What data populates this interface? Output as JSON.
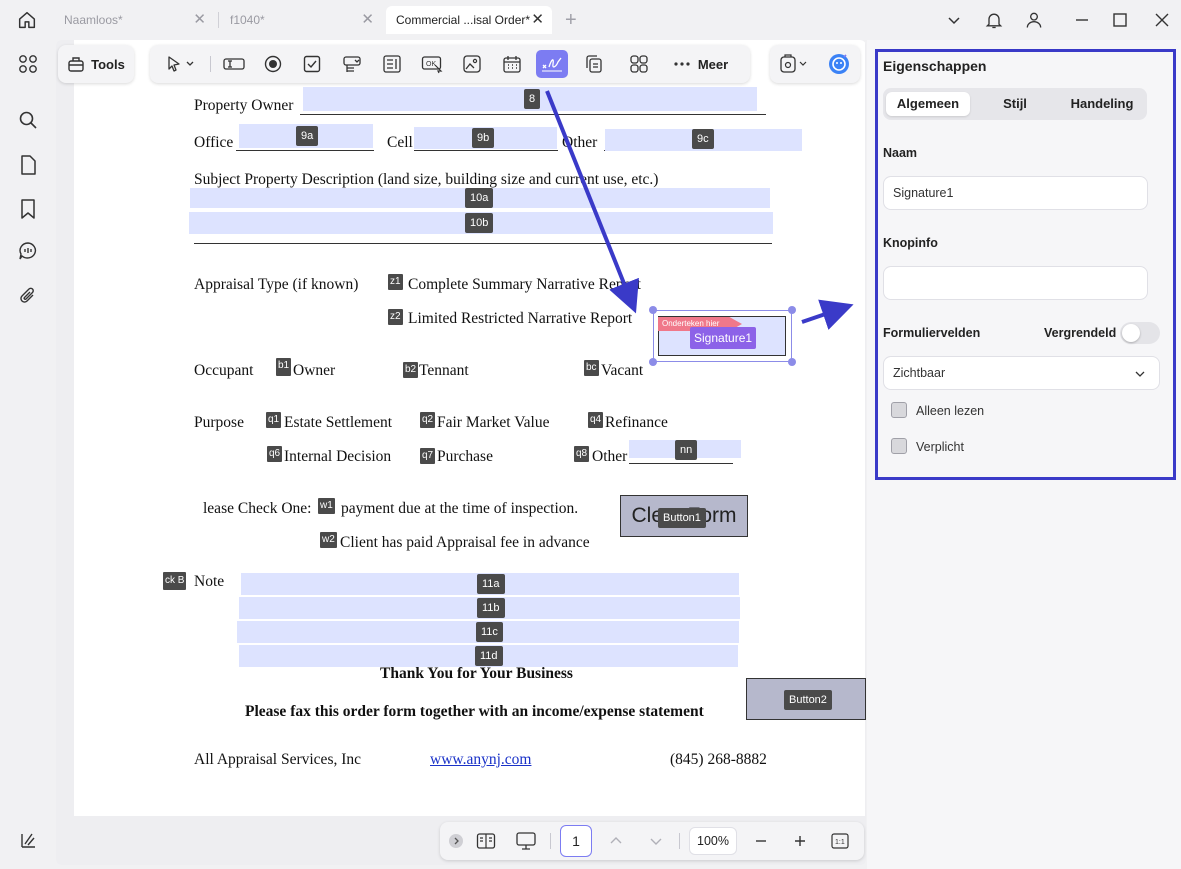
{
  "tabs": [
    {
      "label": "Naamloos*",
      "active": false
    },
    {
      "label": "f1040*",
      "active": false
    },
    {
      "label": "Commercial ...isal Order*",
      "active": true
    }
  ],
  "toolbar": {
    "tools_label": "Tools",
    "more_label": "Meer"
  },
  "document": {
    "property_owner": "Property Owner",
    "office": "Office",
    "cell": "Cell",
    "other": "Other",
    "subject_desc": "Subject Property Description (land size, building size and current use, etc.)",
    "appraisal_type": "Appraisal Type (if known)",
    "complete_summary": "Complete Summary Narrative Report",
    "limited_restricted": "Limited Restricted Narrative Report",
    "occupant": "Occupant",
    "owner": "Owner",
    "tennant": "Tennant",
    "vacant": "Vacant",
    "purpose": "Purpose",
    "estate_settlement": "Estate Settlement",
    "fair_market_value": "Fair Market Value",
    "refinance": "Refinance",
    "internal_decision": "Internal Decision",
    "purchase": "Purchase",
    "other2": "Other",
    "please_check": "lease Check One:",
    "payment_due": "payment due at the time of inspection.",
    "client_paid": "Client has paid Appraisal fee in advance",
    "clear_form": "Clear Form",
    "note": "Note",
    "thank_you": "Thank You for Your Business",
    "fax_order": "Please fax this order form together with an income/expense statement",
    "company": "All Appraisal Services, Inc",
    "website": "www.anynj.com",
    "phone": "(845) 268-8882"
  },
  "fields": {
    "f8": "8",
    "f9a": "9a",
    "f9b": "9b",
    "f9c": "9c",
    "f10a": "10a",
    "f10b": "10b",
    "z1": "z1",
    "z2": "z2",
    "b1": "b1",
    "b2": "b2",
    "bc": "bc",
    "q1": "q1",
    "q2": "q2",
    "q4": "q4",
    "q6": "q6",
    "q7": "q7",
    "q8": "q8",
    "nn": "nn",
    "w1": "w1",
    "w2": "w2",
    "ckb": "ck B",
    "f11a": "11a",
    "f11b": "11b",
    "f11c": "11c",
    "f11d": "11d",
    "button1": "Button1",
    "button2": "Button2",
    "signature": "Signature1",
    "sign_hint": "Onderteken hier"
  },
  "bottombar": {
    "page_number": "1",
    "zoom": "100%"
  },
  "properties": {
    "title": "Eigenschappen",
    "tabs": [
      "Algemeen",
      "Stijl",
      "Handeling"
    ],
    "name_label": "Naam",
    "name_value": "Signature1",
    "tooltip_label": "Knopinfo",
    "tooltip_value": "",
    "form_fields_label": "Formuliervelden",
    "locked_label": "Vergrendeld",
    "locked": false,
    "visibility_value": "Zichtbaar",
    "readonly_label": "Alleen lezen",
    "required_label": "Verplicht"
  },
  "colors": {
    "accent": "#3a3ac8",
    "field_fill": "#dde3ff",
    "active_tool": "#7c7cf2"
  }
}
